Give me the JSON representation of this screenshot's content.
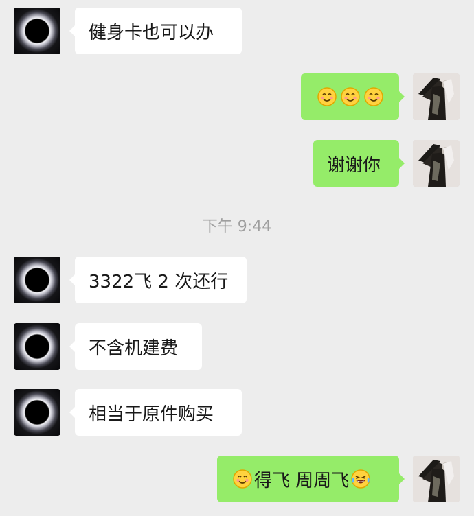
{
  "messages": [
    {
      "side": "left",
      "text": "健身卡也可以办"
    },
    {
      "side": "right",
      "emoji": [
        "smile-emoji",
        "smile-emoji",
        "smile-emoji"
      ]
    },
    {
      "side": "right",
      "text": "谢谢你"
    },
    {
      "side": "left",
      "text": "3322飞 2 次还行"
    },
    {
      "side": "left",
      "text": "不含机建费"
    },
    {
      "side": "left",
      "text": "相当于原件购买"
    },
    {
      "side": "right",
      "text_parts": [
        "得飞 周周飞"
      ],
      "emoji": [
        "smile-emoji",
        "tears-of-joy-emoji"
      ]
    }
  ],
  "timestamp": "下午 9:44",
  "colors": {
    "background": "#ededed",
    "bubble_left": "#ffffff",
    "bubble_right": "#95ec69",
    "text": "#191919",
    "timestamp": "#9e9e9e"
  }
}
